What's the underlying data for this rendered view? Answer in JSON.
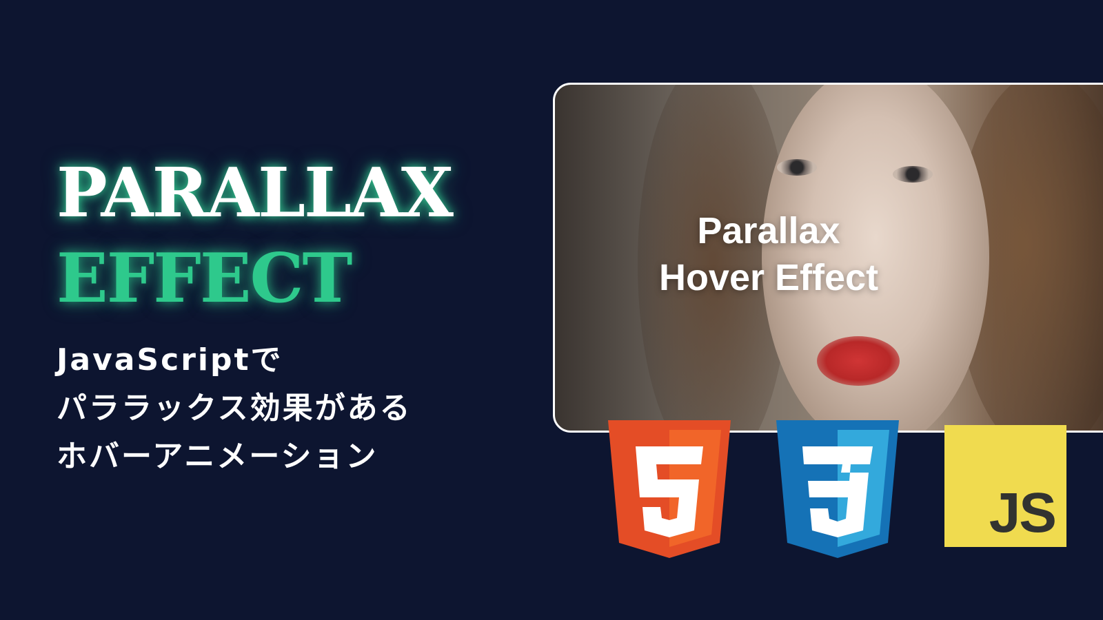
{
  "headline": {
    "line1": "PARALLAX",
    "line2": "EFFECT"
  },
  "subtitle": {
    "line1": "JavaScriptで",
    "line2": "パララックス効果がある",
    "line3": "ホバーアニメーション"
  },
  "card": {
    "title_line1": "Parallax",
    "title_line2": "Hover Effect"
  },
  "logos": {
    "html5_icon": "html5-logo",
    "css3_icon": "css3-logo",
    "js_label": "JS"
  },
  "colors": {
    "background": "#0d1530",
    "accent": "#2ec98c",
    "html5": "#e44d26",
    "css3": "#1572b6",
    "js": "#f0db4f"
  }
}
